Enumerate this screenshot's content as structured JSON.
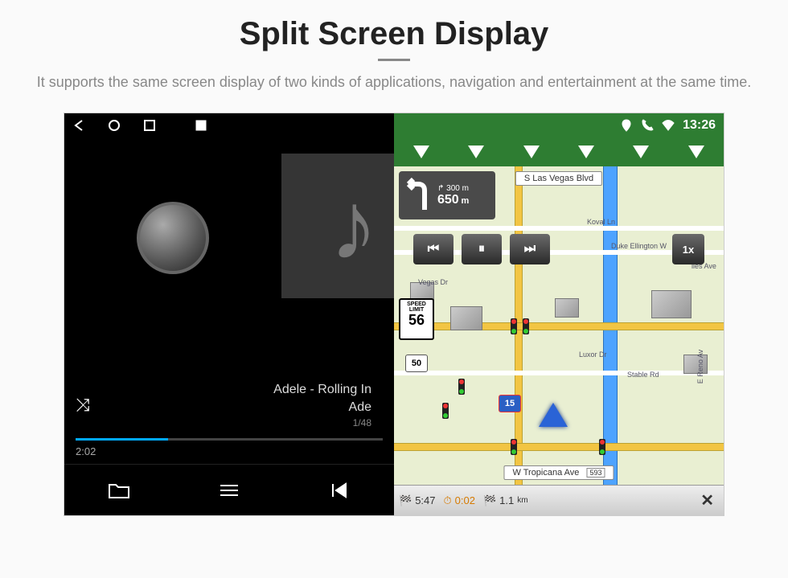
{
  "promo": {
    "title": "Split Screen Display",
    "subtitle": "It supports the same screen display of two kinds of applications, navigation and entertainment at the same time."
  },
  "statusbar": {
    "time": "13:26"
  },
  "music": {
    "track_title": "Adele - Rolling In",
    "artist": "Ade",
    "track_index": "1/48",
    "elapsed": "2:02"
  },
  "nav": {
    "turn": {
      "distance_primary": "650",
      "unit_primary": "m",
      "distance_secondary": "300",
      "unit_secondary": "m"
    },
    "speed_limit": {
      "label": "SPEED LIMIT",
      "value": "56"
    },
    "playback_speed": "1x",
    "streets": {
      "top": "S Las Vegas Blvd",
      "bottom": "W Tropicana Ave",
      "bottom_num": "593",
      "koval": "Koval Ln",
      "duke": "Duke Ellington W",
      "vegas_dr": "Vegas Dr",
      "luxor": "Luxor Dr",
      "stable": "Stable Rd",
      "reno": "E Reno Av",
      "iles": "iles Ave"
    },
    "routes": {
      "rt50": "50",
      "i15": "15"
    },
    "bottom_bar": {
      "eta": "5:47",
      "time_remaining": "0:02",
      "distance_remaining": "1.1",
      "distance_unit": "km"
    }
  }
}
